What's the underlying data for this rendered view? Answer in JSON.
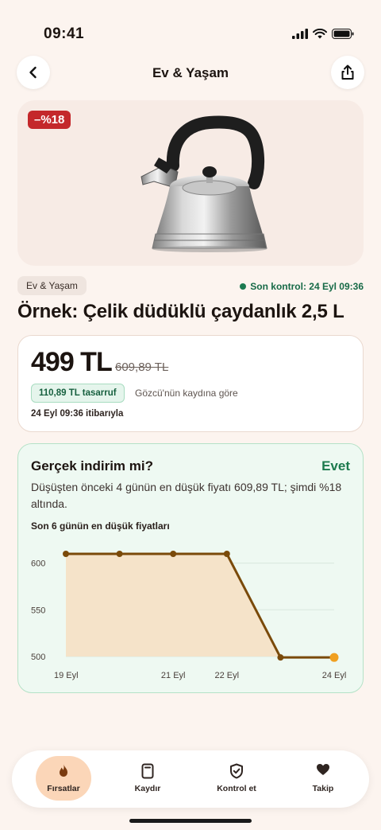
{
  "status_bar": {
    "time": "09:41"
  },
  "nav": {
    "title": "Ev & Yaşam",
    "back_icon": "chevron-left-icon",
    "share_icon": "share-icon"
  },
  "product": {
    "discount_badge": "–%18",
    "category": "Ev & Yaşam",
    "last_check": "Son kontrol: 24 Eyl 09:36",
    "title": "Örnek: Çelik düdüklü çaydanlık 2,5 L"
  },
  "price": {
    "current": "499 TL",
    "old": "609,89 TL",
    "savings": "110,89 TL tasarruf",
    "savings_note": "Gözcü'nün kaydına göre",
    "as_of": "24 Eyl 09:36 itibarıyla"
  },
  "verdict": {
    "question": "Gerçek indirim mi?",
    "answer": "Evet",
    "answer_color": "#1d7a4e",
    "description": "Düşüşten önceki 4 günün en düşük fiyatı 609,89 TL; şimdi %18 altında.",
    "chart_title": "Son 6 günün en düşük fiyatları"
  },
  "chart_data": {
    "type": "area",
    "x": [
      "19 Eyl",
      "20 Eyl",
      "21 Eyl",
      "22 Eyl",
      "23 Eyl",
      "24 Eyl"
    ],
    "x_tick_labels": [
      "19 Eyl",
      "21 Eyl",
      "22 Eyl",
      "24 Eyl"
    ],
    "series": [
      {
        "values": [
          609.89,
          609.89,
          609.89,
          609.89,
          499,
          499
        ]
      }
    ],
    "y_ticks": [
      500,
      550,
      600
    ],
    "ylim": [
      500,
      615
    ],
    "grid": true,
    "line_color": "#7a4a0a",
    "fill_color": "#f5e3c9",
    "last_point_color": "#f0a020"
  },
  "tabs": [
    {
      "label": "Fırsatlar",
      "icon": "flame-icon",
      "active": true
    },
    {
      "label": "Kaydır",
      "icon": "phone-card-icon",
      "active": false
    },
    {
      "label": "Kontrol et",
      "icon": "shield-check-icon",
      "active": false
    },
    {
      "label": "Takip",
      "icon": "heart-icon",
      "active": false
    }
  ]
}
